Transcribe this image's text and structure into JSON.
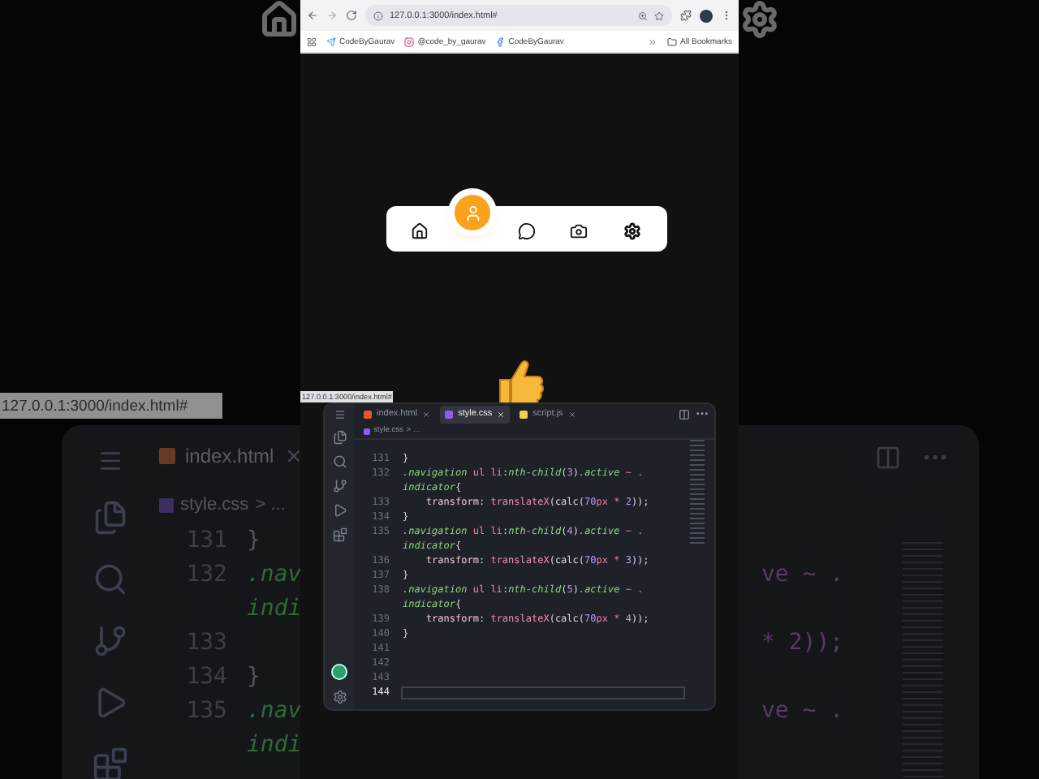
{
  "background": {
    "url_chip": "127.0.0.1:3000/index.html#",
    "tab": "index.html",
    "breadcrumb": "style.css",
    "breadcrumb_rest": "> ...",
    "rows": [
      {
        "number": "131",
        "left": "}",
        "right": ""
      },
      {
        "number": "132",
        "left": ".nav",
        "right": "ve ~ ."
      },
      {
        "number": "",
        "left": "indi",
        "right": ""
      },
      {
        "number": "133",
        "left": "",
        "right": "* 2));"
      },
      {
        "number": "134",
        "left": "}",
        "right": ""
      },
      {
        "number": "135",
        "left": ".nav",
        "right": "ve ~ ."
      },
      {
        "number": "",
        "left": "indi",
        "right": ""
      }
    ]
  },
  "browser": {
    "url": "127.0.0.1:3000/index.html#",
    "bookmarks": [
      {
        "kind": "telegram",
        "label": "CodeByGaurav"
      },
      {
        "kind": "instagram",
        "label": "@code_by_gaurav"
      },
      {
        "kind": "facebook",
        "label": "CodeByGaurav"
      }
    ],
    "all_bookmarks": "All Bookmarks"
  },
  "nav": {
    "items": [
      {
        "kind": "home",
        "selected": false
      },
      {
        "kind": "user",
        "selected": true
      },
      {
        "kind": "chat",
        "selected": false
      },
      {
        "kind": "camera",
        "selected": false
      },
      {
        "kind": "settings",
        "selected": false
      }
    ]
  },
  "status_url": "127.0.0.1:3000/index.html#",
  "editor": {
    "tabs": [
      {
        "kind": "html",
        "label": "index.html",
        "selected": false
      },
      {
        "kind": "css",
        "label": "style.css",
        "selected": true
      },
      {
        "kind": "js",
        "label": "script.js",
        "selected": false
      }
    ],
    "breadcrumb": "style.css",
    "breadcrumb_rest": "> ...",
    "rows": [
      {
        "number": "131",
        "current": false,
        "tokens": [
          {
            "kind": "plain",
            "text": "}"
          }
        ]
      },
      {
        "number": "132",
        "current": false,
        "tokens": [
          {
            "kind": "class",
            "text": ".navigation"
          },
          {
            "kind": "tag",
            "text": " ul li"
          },
          {
            "kind": "plain",
            "text": ":"
          },
          {
            "kind": "class",
            "text": "nth-child"
          },
          {
            "kind": "plain",
            "text": "("
          },
          {
            "kind": "num",
            "text": "3"
          },
          {
            "kind": "plain",
            "text": ")"
          },
          {
            "kind": "class",
            "text": ".active"
          },
          {
            "kind": "op",
            "text": " ~ ."
          }
        ]
      },
      {
        "number": "",
        "current": false,
        "tokens": [
          {
            "kind": "class",
            "text": "indicator"
          },
          {
            "kind": "plain",
            "text": "{"
          }
        ]
      },
      {
        "number": "133",
        "current": false,
        "tokens": [
          {
            "kind": "prop",
            "text": "    transform"
          },
          {
            "kind": "plain",
            "text": ": "
          },
          {
            "kind": "fn",
            "text": "translateX"
          },
          {
            "kind": "plain",
            "text": "(calc("
          },
          {
            "kind": "num",
            "text": "70"
          },
          {
            "kind": "op",
            "text": "px * "
          },
          {
            "kind": "num",
            "text": "2"
          },
          {
            "kind": "plain",
            "text": "));"
          }
        ]
      },
      {
        "number": "134",
        "current": false,
        "tokens": [
          {
            "kind": "plain",
            "text": "}"
          }
        ]
      },
      {
        "number": "135",
        "current": false,
        "tokens": [
          {
            "kind": "class",
            "text": ".navigation"
          },
          {
            "kind": "tag",
            "text": " ul li"
          },
          {
            "kind": "plain",
            "text": ":"
          },
          {
            "kind": "class",
            "text": "nth-child"
          },
          {
            "kind": "plain",
            "text": "("
          },
          {
            "kind": "num",
            "text": "4"
          },
          {
            "kind": "plain",
            "text": ")"
          },
          {
            "kind": "class",
            "text": ".active"
          },
          {
            "kind": "op",
            "text": " ~ ."
          }
        ]
      },
      {
        "number": "",
        "current": false,
        "tokens": [
          {
            "kind": "class",
            "text": "indicator"
          },
          {
            "kind": "plain",
            "text": "{"
          }
        ]
      },
      {
        "number": "136",
        "current": false,
        "tokens": [
          {
            "kind": "prop",
            "text": "    transform"
          },
          {
            "kind": "plain",
            "text": ": "
          },
          {
            "kind": "fn",
            "text": "translateX"
          },
          {
            "kind": "plain",
            "text": "(calc("
          },
          {
            "kind": "num",
            "text": "70"
          },
          {
            "kind": "op",
            "text": "px * "
          },
          {
            "kind": "num",
            "text": "3"
          },
          {
            "kind": "plain",
            "text": "));"
          }
        ]
      },
      {
        "number": "137",
        "current": false,
        "tokens": [
          {
            "kind": "plain",
            "text": "}"
          }
        ]
      },
      {
        "number": "138",
        "current": false,
        "tokens": [
          {
            "kind": "class",
            "text": ".navigation"
          },
          {
            "kind": "tag",
            "text": " ul li"
          },
          {
            "kind": "plain",
            "text": ":"
          },
          {
            "kind": "class",
            "text": "nth-child"
          },
          {
            "kind": "plain",
            "text": "("
          },
          {
            "kind": "num",
            "text": "5"
          },
          {
            "kind": "plain",
            "text": ")"
          },
          {
            "kind": "class",
            "text": ".active"
          },
          {
            "kind": "op",
            "text": " ~ ."
          }
        ]
      },
      {
        "number": "",
        "current": false,
        "tokens": [
          {
            "kind": "class",
            "text": "indicator"
          },
          {
            "kind": "plain",
            "text": "{"
          }
        ]
      },
      {
        "number": "139",
        "current": false,
        "tokens": [
          {
            "kind": "prop",
            "text": "    transform"
          },
          {
            "kind": "plain",
            "text": ": "
          },
          {
            "kind": "fn",
            "text": "translateX"
          },
          {
            "kind": "plain",
            "text": "(calc("
          },
          {
            "kind": "num",
            "text": "70"
          },
          {
            "kind": "op",
            "text": "px * "
          },
          {
            "kind": "num",
            "text": "4"
          },
          {
            "kind": "plain",
            "text": "));"
          }
        ]
      },
      {
        "number": "140",
        "current": false,
        "tokens": [
          {
            "kind": "plain",
            "text": "}"
          }
        ]
      },
      {
        "number": "141",
        "current": false,
        "tokens": []
      },
      {
        "number": "142",
        "current": false,
        "tokens": []
      },
      {
        "number": "143",
        "current": false,
        "tokens": []
      },
      {
        "number": "144",
        "current": true,
        "tokens": []
      }
    ]
  }
}
